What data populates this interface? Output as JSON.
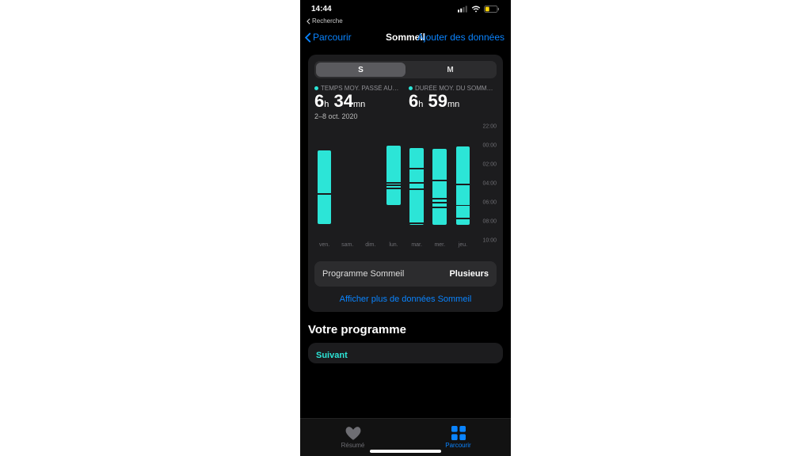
{
  "status": {
    "time": "14:44",
    "breadcrumb": "Recherche"
  },
  "nav": {
    "back": "Parcourir",
    "title": "Sommeil",
    "action": "Ajouter des données"
  },
  "segmented": {
    "options": [
      "S",
      "M"
    ],
    "selected": 0
  },
  "metrics": [
    {
      "label": "TEMPS MOY. PASSÉ AU…",
      "h": "6",
      "m": "34"
    },
    {
      "label": "DURÉE MOY. DU SOMM…",
      "h": "6",
      "m": "59"
    }
  ],
  "units": {
    "h": "h",
    "m": "mn"
  },
  "date_range": "2–8 oct. 2020",
  "chart_data": {
    "type": "bar",
    "y_axis_hours": [
      22,
      0,
      2,
      4,
      6,
      8,
      10
    ],
    "y_labels": [
      "22:00",
      "00:00",
      "02:00",
      "04:00",
      "06:00",
      "08:00",
      "10:00"
    ],
    "categories": [
      "ven.",
      "sam.",
      "dim.",
      "lun.",
      "mar.",
      "mer.",
      "jeu."
    ],
    "series": [
      {
        "name": "Sommeil",
        "note": "start/end given as hours on 22–10 scale; gaps are awake segments in hours",
        "bars": [
          {
            "day": "ven.",
            "start": 0.5,
            "end": 8.2,
            "gaps": [
              [
                5.0,
                5.1
              ]
            ]
          },
          {
            "day": "sam.",
            "start": null,
            "end": null,
            "gaps": []
          },
          {
            "day": "dim.",
            "start": null,
            "end": null,
            "gaps": []
          },
          {
            "day": "lun.",
            "start": 0.0,
            "end": 6.2,
            "gaps": [
              [
                3.8,
                3.95
              ],
              [
                4.1,
                4.2
              ],
              [
                4.4,
                4.5
              ]
            ]
          },
          {
            "day": "mar.",
            "start": 0.2,
            "end": 8.3,
            "gaps": [
              [
                2.3,
                2.4
              ],
              [
                3.8,
                4.0
              ],
              [
                4.5,
                4.6
              ],
              [
                8.05,
                8.15
              ]
            ]
          },
          {
            "day": "mer.",
            "start": 0.3,
            "end": 8.3,
            "gaps": [
              [
                3.6,
                3.7
              ],
              [
                5.5,
                5.65
              ],
              [
                5.9,
                6.05
              ],
              [
                6.4,
                6.5
              ]
            ]
          },
          {
            "day": "jeu.",
            "start": 0.1,
            "end": 8.3,
            "gaps": [
              [
                4.0,
                4.15
              ],
              [
                6.2,
                6.35
              ],
              [
                7.55,
                7.7
              ]
            ]
          }
        ]
      }
    ]
  },
  "program_row": {
    "label": "Programme Sommeil",
    "value": "Plusieurs"
  },
  "more_link": "Afficher plus de données Sommeil",
  "section_title": "Votre programme",
  "next_label": "Suivant",
  "tabs": [
    {
      "label": "Résumé",
      "active": false
    },
    {
      "label": "Parcourir",
      "active": true
    }
  ]
}
